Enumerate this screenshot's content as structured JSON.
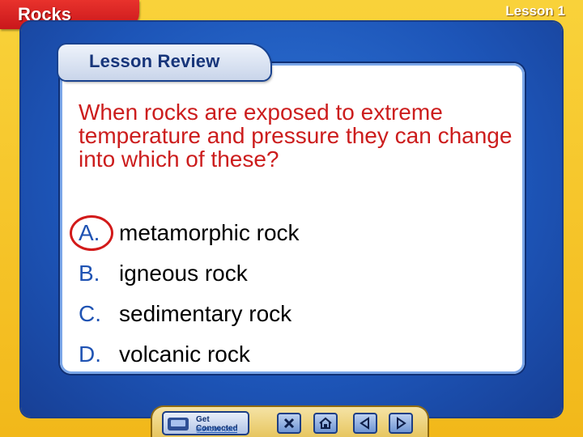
{
  "header": {
    "topic": "Rocks",
    "lesson": "Lesson 1"
  },
  "panel": {
    "title": "Lesson Review"
  },
  "question": {
    "text": "When rocks are exposed to extreme temperature and pressure they can change into which of these?"
  },
  "answers": [
    {
      "letter": "A.",
      "text": "metamorphic rock",
      "selected": true
    },
    {
      "letter": "B.",
      "text": "igneous rock",
      "selected": false
    },
    {
      "letter": "C.",
      "text": "sedimentary rock",
      "selected": false
    },
    {
      "letter": "D.",
      "text": "volcanic rock",
      "selected": false
    }
  ],
  "nav": {
    "get_connected_title": "Get Connected",
    "get_connected_url": "glencoe.com",
    "icons": [
      "close-icon",
      "home-icon",
      "previous-icon",
      "next-icon"
    ]
  },
  "colors": {
    "question": "#cc1d1d",
    "letter": "#1f53b3",
    "ring": "#d21a1a",
    "panel": "#1d55b8",
    "frame": "#f2b81a",
    "topic_tab": "#c9171b"
  }
}
